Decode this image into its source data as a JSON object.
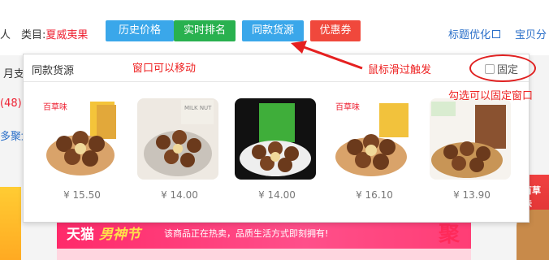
{
  "header": {
    "left_fragment": "人",
    "category_label": "类目:",
    "category_value": "夏威夷果",
    "buttons": [
      {
        "label": "历史价格",
        "color": "#3aa7ea"
      },
      {
        "label": "实时排名",
        "color": "#29b14f"
      },
      {
        "label": "同款货源",
        "color": "#3aa7ea"
      },
      {
        "label": "优惠券",
        "color": "#f0483c"
      }
    ],
    "title_optimize": "标题优化",
    "baby_tab": "宝贝分"
  },
  "left_fragments": [
    "月支",
    "(48)",
    "多聚划"
  ],
  "popup": {
    "title": "同款货源",
    "fix_label": "固定",
    "products": [
      {
        "price": "¥ 15.50",
        "brand": "百草味"
      },
      {
        "price": "¥ 14.00",
        "brand": "MILK NUT"
      },
      {
        "price": "¥ 14.00",
        "brand": ""
      },
      {
        "price": "¥ 16.10",
        "brand": "百草味"
      },
      {
        "price": "¥ 13.90",
        "brand": ""
      }
    ]
  },
  "annotations": {
    "movable": "窗口可以移动",
    "hover_trigger": "鼠标滑过触发",
    "check_fix": "勾选可以固定窗口"
  },
  "banner": {
    "tmall": "天猫",
    "festival": "男神节",
    "slogan": "该商品正在热卖，品质生活方式即刻拥有!",
    "ju": "聚"
  },
  "right_banner": "百草味",
  "colors": {
    "accent_red": "#ee2222",
    "link_blue": "#2a6fc9"
  }
}
